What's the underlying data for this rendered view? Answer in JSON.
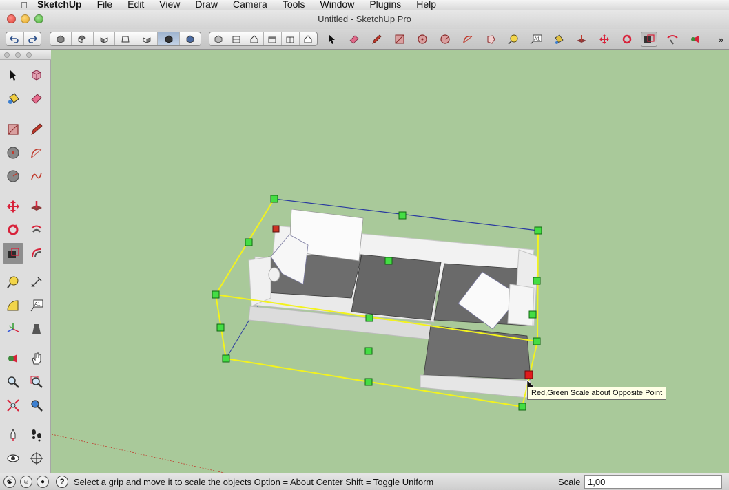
{
  "menubar": {
    "app_name": "SketchUp",
    "items": [
      "File",
      "Edit",
      "View",
      "Draw",
      "Camera",
      "Tools",
      "Window",
      "Plugins",
      "Help"
    ]
  },
  "window": {
    "title": "Untitled - SketchUp Pro"
  },
  "toolbar": {
    "more_label": "»",
    "icons": [
      "undo-icon",
      "redo-icon",
      "iso-view-icon",
      "top-view-icon",
      "front-view-icon",
      "right-view-icon",
      "back-view-icon",
      "left-view-icon",
      "xray-style-icon",
      "wireframe-style-icon",
      "hidden-line-style-icon",
      "shaded-style-icon",
      "shaded-textures-style-icon",
      "monochrome-style-icon",
      "select-icon",
      "eraser-icon",
      "pencil-icon",
      "rectangle-icon",
      "circle-icon",
      "polygon-icon",
      "arc-icon",
      "freehand-icon",
      "tape-measure-icon",
      "text-icon",
      "paint-bucket-icon",
      "push-pull-icon",
      "move-icon",
      "rotate-icon",
      "scale-icon",
      "follow-me-icon",
      "orbit-icon"
    ]
  },
  "palette": {
    "tools": [
      "select",
      "make-component",
      "paint-bucket",
      "eraser",
      "rectangle",
      "pencil",
      "circle",
      "arc",
      "polygon",
      "freehand",
      "move",
      "push-pull",
      "rotate",
      "follow-me",
      "scale",
      "offset",
      "tape-measure",
      "dimension",
      "protractor",
      "text",
      "axes",
      "3d-text",
      "orbit",
      "pan",
      "zoom",
      "zoom-window",
      "zoom-extents",
      "previous-view",
      "position-camera",
      "walk",
      "look-around",
      "section-plane"
    ],
    "active_tool": "scale"
  },
  "canvas": {
    "background": "#a9c99a",
    "tooltip": "Red,Green Scale about Opposite Point"
  },
  "statusbar": {
    "prompt": "Select a grip and move it to scale the objects  Option = About Center  Shift = Toggle Uniform",
    "help_label": "?",
    "scale_label": "Scale",
    "scale_value": "1,00"
  }
}
